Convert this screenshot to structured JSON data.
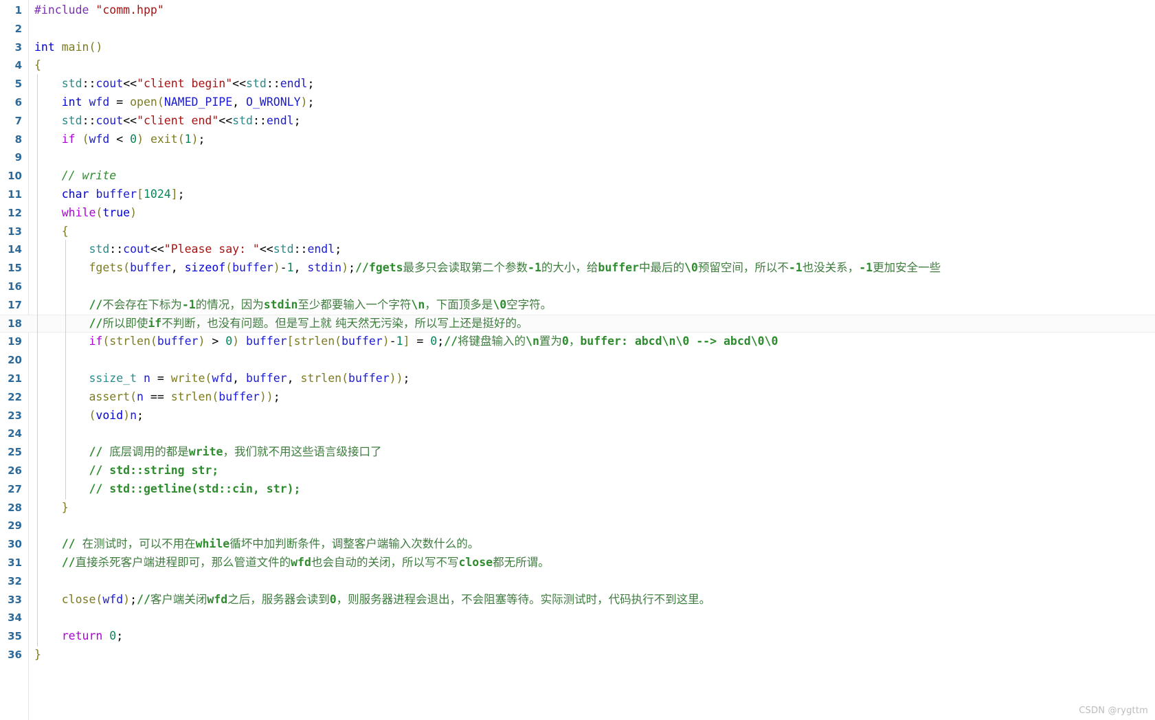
{
  "editor": {
    "language": "cpp",
    "current_line": 18,
    "total_lines": 36,
    "background_color": "#ffffff",
    "line_number_color": "#2b6a9b",
    "colors": {
      "preprocessor": "#7b2fb5",
      "string": "#a31515",
      "keyword": "#0000d8",
      "control": "#af00db",
      "type": "#2b8a8a",
      "function": "#7d7a1f",
      "number": "#098658",
      "variable": "#1b1bd0",
      "comment": "#2e8b2e",
      "plain": "#000000"
    }
  },
  "watermark": "CSDN @rygttm",
  "lines": [
    {
      "n": 1,
      "indent": 0,
      "tokens": [
        {
          "c": "t-pre",
          "t": "#include"
        },
        {
          "c": "t-plain",
          "t": " "
        },
        {
          "c": "t-str",
          "t": "\"comm.hpp\""
        }
      ]
    },
    {
      "n": 2,
      "indent": 0,
      "tokens": []
    },
    {
      "n": 3,
      "indent": 0,
      "tokens": [
        {
          "c": "t-kw",
          "t": "int"
        },
        {
          "c": "t-plain",
          "t": " "
        },
        {
          "c": "t-fn",
          "t": "main"
        },
        {
          "c": "t-brk",
          "t": "()"
        }
      ]
    },
    {
      "n": 4,
      "indent": 0,
      "tokens": [
        {
          "c": "t-brk",
          "t": "{"
        }
      ]
    },
    {
      "n": 5,
      "indent": 1,
      "tokens": [
        {
          "c": "t-ns",
          "t": "std"
        },
        {
          "c": "t-plain",
          "t": "::"
        },
        {
          "c": "t-var",
          "t": "cout"
        },
        {
          "c": "t-plain",
          "t": "<<"
        },
        {
          "c": "t-str",
          "t": "\"client begin\""
        },
        {
          "c": "t-plain",
          "t": "<<"
        },
        {
          "c": "t-ns",
          "t": "std"
        },
        {
          "c": "t-plain",
          "t": "::"
        },
        {
          "c": "t-var",
          "t": "endl"
        },
        {
          "c": "t-plain",
          "t": ";"
        }
      ]
    },
    {
      "n": 6,
      "indent": 1,
      "tokens": [
        {
          "c": "t-kw",
          "t": "int"
        },
        {
          "c": "t-plain",
          "t": " "
        },
        {
          "c": "t-var",
          "t": "wfd"
        },
        {
          "c": "t-plain",
          "t": " = "
        },
        {
          "c": "t-fn",
          "t": "open"
        },
        {
          "c": "t-brk",
          "t": "("
        },
        {
          "c": "t-var",
          "t": "NAMED_PIPE"
        },
        {
          "c": "t-plain",
          "t": ", "
        },
        {
          "c": "t-var",
          "t": "O_WRONLY"
        },
        {
          "c": "t-brk",
          "t": ")"
        },
        {
          "c": "t-plain",
          "t": ";"
        }
      ]
    },
    {
      "n": 7,
      "indent": 1,
      "tokens": [
        {
          "c": "t-ns",
          "t": "std"
        },
        {
          "c": "t-plain",
          "t": "::"
        },
        {
          "c": "t-var",
          "t": "cout"
        },
        {
          "c": "t-plain",
          "t": "<<"
        },
        {
          "c": "t-str",
          "t": "\"client end\""
        },
        {
          "c": "t-plain",
          "t": "<<"
        },
        {
          "c": "t-ns",
          "t": "std"
        },
        {
          "c": "t-plain",
          "t": "::"
        },
        {
          "c": "t-var",
          "t": "endl"
        },
        {
          "c": "t-plain",
          "t": ";"
        }
      ]
    },
    {
      "n": 8,
      "indent": 1,
      "tokens": [
        {
          "c": "t-ctrl",
          "t": "if"
        },
        {
          "c": "t-plain",
          "t": " "
        },
        {
          "c": "t-brk",
          "t": "("
        },
        {
          "c": "t-var",
          "t": "wfd"
        },
        {
          "c": "t-plain",
          "t": " < "
        },
        {
          "c": "t-num",
          "t": "0"
        },
        {
          "c": "t-brk",
          "t": ")"
        },
        {
          "c": "t-plain",
          "t": " "
        },
        {
          "c": "t-fn",
          "t": "exit"
        },
        {
          "c": "t-brk",
          "t": "("
        },
        {
          "c": "t-num",
          "t": "1"
        },
        {
          "c": "t-brk",
          "t": ")"
        },
        {
          "c": "t-plain",
          "t": ";"
        }
      ]
    },
    {
      "n": 9,
      "indent": 1,
      "tokens": []
    },
    {
      "n": 10,
      "indent": 1,
      "tokens": [
        {
          "c": "t-com",
          "t": "// write"
        }
      ]
    },
    {
      "n": 11,
      "indent": 1,
      "tokens": [
        {
          "c": "t-kw",
          "t": "char"
        },
        {
          "c": "t-plain",
          "t": " "
        },
        {
          "c": "t-var",
          "t": "buffer"
        },
        {
          "c": "t-brk",
          "t": "["
        },
        {
          "c": "t-num",
          "t": "1024"
        },
        {
          "c": "t-brk",
          "t": "]"
        },
        {
          "c": "t-plain",
          "t": ";"
        }
      ]
    },
    {
      "n": 12,
      "indent": 1,
      "tokens": [
        {
          "c": "t-ctrl",
          "t": "while"
        },
        {
          "c": "t-brk",
          "t": "("
        },
        {
          "c": "t-kw",
          "t": "true"
        },
        {
          "c": "t-brk",
          "t": ")"
        }
      ]
    },
    {
      "n": 13,
      "indent": 1,
      "tokens": [
        {
          "c": "t-brk",
          "t": "{"
        }
      ]
    },
    {
      "n": 14,
      "indent": 2,
      "tokens": [
        {
          "c": "t-ns",
          "t": "std"
        },
        {
          "c": "t-plain",
          "t": "::"
        },
        {
          "c": "t-var",
          "t": "cout"
        },
        {
          "c": "t-plain",
          "t": "<<"
        },
        {
          "c": "t-str",
          "t": "\"Please say: \""
        },
        {
          "c": "t-plain",
          "t": "<<"
        },
        {
          "c": "t-ns",
          "t": "std"
        },
        {
          "c": "t-plain",
          "t": "::"
        },
        {
          "c": "t-var",
          "t": "endl"
        },
        {
          "c": "t-plain",
          "t": ";"
        }
      ]
    },
    {
      "n": 15,
      "indent": 2,
      "tokens": [
        {
          "c": "t-fn",
          "t": "fgets"
        },
        {
          "c": "t-brk",
          "t": "("
        },
        {
          "c": "t-var",
          "t": "buffer"
        },
        {
          "c": "t-plain",
          "t": ", "
        },
        {
          "c": "t-kw",
          "t": "sizeof"
        },
        {
          "c": "t-brk",
          "t": "("
        },
        {
          "c": "t-var",
          "t": "buffer"
        },
        {
          "c": "t-brk",
          "t": ")"
        },
        {
          "c": "t-plain",
          "t": "-"
        },
        {
          "c": "t-num",
          "t": "1"
        },
        {
          "c": "t-plain",
          "t": ", "
        },
        {
          "c": "t-var",
          "t": "stdin"
        },
        {
          "c": "t-brk",
          "t": ")"
        },
        {
          "c": "t-plain",
          "t": ";"
        },
        {
          "c": "t-com-code",
          "t": "//fgets"
        },
        {
          "c": "t-com-cjk",
          "t": "最多只会读取第二个参数"
        },
        {
          "c": "t-com-code",
          "t": "-1"
        },
        {
          "c": "t-com-cjk",
          "t": "的大小，给"
        },
        {
          "c": "t-com-code",
          "t": "buffer"
        },
        {
          "c": "t-com-cjk",
          "t": "中最后的"
        },
        {
          "c": "t-com-code",
          "t": "\\0"
        },
        {
          "c": "t-com-cjk",
          "t": "预留空间，所以不"
        },
        {
          "c": "t-com-code",
          "t": "-1"
        },
        {
          "c": "t-com-cjk",
          "t": "也没关系，"
        },
        {
          "c": "t-com-code",
          "t": "-1"
        },
        {
          "c": "t-com-cjk",
          "t": "更加安全一些"
        }
      ]
    },
    {
      "n": 16,
      "indent": 2,
      "tokens": []
    },
    {
      "n": 17,
      "indent": 2,
      "tokens": [
        {
          "c": "t-com-code",
          "t": "//"
        },
        {
          "c": "t-com-cjk",
          "t": "不会存在下标为"
        },
        {
          "c": "t-com-code",
          "t": "-1"
        },
        {
          "c": "t-com-cjk",
          "t": "的情况，因为"
        },
        {
          "c": "t-com-code",
          "t": "stdin"
        },
        {
          "c": "t-com-cjk",
          "t": "至少都要输入一个字符"
        },
        {
          "c": "t-com-code",
          "t": "\\n"
        },
        {
          "c": "t-com-cjk",
          "t": "，下面顶多是"
        },
        {
          "c": "t-com-code",
          "t": "\\0"
        },
        {
          "c": "t-com-cjk",
          "t": "空字符。"
        }
      ]
    },
    {
      "n": 18,
      "indent": 2,
      "tokens": [
        {
          "c": "t-com-code",
          "t": "//"
        },
        {
          "c": "t-com-cjk",
          "t": "所以即使"
        },
        {
          "c": "t-com-code",
          "t": "if"
        },
        {
          "c": "t-com-cjk",
          "t": "不判断，也没有问题。但是写上就 纯天然无污染，所以写上还是挺好的。"
        }
      ]
    },
    {
      "n": 19,
      "indent": 2,
      "tokens": [
        {
          "c": "t-ctrl",
          "t": "if"
        },
        {
          "c": "t-brk",
          "t": "("
        },
        {
          "c": "t-fn",
          "t": "strlen"
        },
        {
          "c": "t-brk",
          "t": "("
        },
        {
          "c": "t-var",
          "t": "buffer"
        },
        {
          "c": "t-brk",
          "t": ")"
        },
        {
          "c": "t-plain",
          "t": " > "
        },
        {
          "c": "t-num",
          "t": "0"
        },
        {
          "c": "t-brk",
          "t": ")"
        },
        {
          "c": "t-plain",
          "t": " "
        },
        {
          "c": "t-var",
          "t": "buffer"
        },
        {
          "c": "t-brk",
          "t": "["
        },
        {
          "c": "t-fn",
          "t": "strlen"
        },
        {
          "c": "t-brk",
          "t": "("
        },
        {
          "c": "t-var",
          "t": "buffer"
        },
        {
          "c": "t-brk",
          "t": ")"
        },
        {
          "c": "t-plain",
          "t": "-"
        },
        {
          "c": "t-num",
          "t": "1"
        },
        {
          "c": "t-brk",
          "t": "]"
        },
        {
          "c": "t-plain",
          "t": " = "
        },
        {
          "c": "t-num",
          "t": "0"
        },
        {
          "c": "t-plain",
          "t": ";"
        },
        {
          "c": "t-com-code",
          "t": "//"
        },
        {
          "c": "t-com-cjk",
          "t": "将键盘输入的"
        },
        {
          "c": "t-com-code",
          "t": "\\n"
        },
        {
          "c": "t-com-cjk",
          "t": "置为"
        },
        {
          "c": "t-com-code",
          "t": "0"
        },
        {
          "c": "t-com-cjk",
          "t": "，"
        },
        {
          "c": "t-com-code",
          "t": "buffer: abcd\\n\\0 --> abcd\\0\\0"
        }
      ]
    },
    {
      "n": 20,
      "indent": 2,
      "tokens": []
    },
    {
      "n": 21,
      "indent": 2,
      "tokens": [
        {
          "c": "t-type",
          "t": "ssize_t"
        },
        {
          "c": "t-plain",
          "t": " "
        },
        {
          "c": "t-var",
          "t": "n"
        },
        {
          "c": "t-plain",
          "t": " = "
        },
        {
          "c": "t-fn",
          "t": "write"
        },
        {
          "c": "t-brk",
          "t": "("
        },
        {
          "c": "t-var",
          "t": "wfd"
        },
        {
          "c": "t-plain",
          "t": ", "
        },
        {
          "c": "t-var",
          "t": "buffer"
        },
        {
          "c": "t-plain",
          "t": ", "
        },
        {
          "c": "t-fn",
          "t": "strlen"
        },
        {
          "c": "t-brk",
          "t": "("
        },
        {
          "c": "t-var",
          "t": "buffer"
        },
        {
          "c": "t-brk",
          "t": "))"
        },
        {
          "c": "t-plain",
          "t": ";"
        }
      ]
    },
    {
      "n": 22,
      "indent": 2,
      "tokens": [
        {
          "c": "t-fn",
          "t": "assert"
        },
        {
          "c": "t-brk",
          "t": "("
        },
        {
          "c": "t-var",
          "t": "n"
        },
        {
          "c": "t-plain",
          "t": " == "
        },
        {
          "c": "t-fn",
          "t": "strlen"
        },
        {
          "c": "t-brk",
          "t": "("
        },
        {
          "c": "t-var",
          "t": "buffer"
        },
        {
          "c": "t-brk",
          "t": "))"
        },
        {
          "c": "t-plain",
          "t": ";"
        }
      ]
    },
    {
      "n": 23,
      "indent": 2,
      "tokens": [
        {
          "c": "t-brk",
          "t": "("
        },
        {
          "c": "t-kw",
          "t": "void"
        },
        {
          "c": "t-brk",
          "t": ")"
        },
        {
          "c": "t-var",
          "t": "n"
        },
        {
          "c": "t-plain",
          "t": ";"
        }
      ]
    },
    {
      "n": 24,
      "indent": 2,
      "tokens": []
    },
    {
      "n": 25,
      "indent": 2,
      "tokens": [
        {
          "c": "t-com-code",
          "t": "// "
        },
        {
          "c": "t-com-cjk",
          "t": "底层调用的都是"
        },
        {
          "c": "t-com-code",
          "t": "write"
        },
        {
          "c": "t-com-cjk",
          "t": "，我们就不用这些语言级接口了"
        }
      ]
    },
    {
      "n": 26,
      "indent": 2,
      "tokens": [
        {
          "c": "t-com-code",
          "t": "// std::string str;"
        }
      ]
    },
    {
      "n": 27,
      "indent": 2,
      "tokens": [
        {
          "c": "t-com-code",
          "t": "// std::getline(std::cin, str);"
        }
      ]
    },
    {
      "n": 28,
      "indent": 1,
      "tokens": [
        {
          "c": "t-brk",
          "t": "}"
        }
      ]
    },
    {
      "n": 29,
      "indent": 1,
      "tokens": []
    },
    {
      "n": 30,
      "indent": 1,
      "tokens": [
        {
          "c": "t-com-code",
          "t": "// "
        },
        {
          "c": "t-com-cjk",
          "t": "在测试时，可以不用在"
        },
        {
          "c": "t-com-code",
          "t": "while"
        },
        {
          "c": "t-com-cjk",
          "t": "循坏中加判断条件，调整客户端输入次数什么的。"
        }
      ]
    },
    {
      "n": 31,
      "indent": 1,
      "tokens": [
        {
          "c": "t-com-code",
          "t": "//"
        },
        {
          "c": "t-com-cjk",
          "t": "直接杀死客户端进程即可，那么管道文件的"
        },
        {
          "c": "t-com-code",
          "t": "wfd"
        },
        {
          "c": "t-com-cjk",
          "t": "也会自动的关闭，所以写不写"
        },
        {
          "c": "t-com-code",
          "t": "close"
        },
        {
          "c": "t-com-cjk",
          "t": "都无所谓。"
        }
      ]
    },
    {
      "n": 32,
      "indent": 1,
      "tokens": []
    },
    {
      "n": 33,
      "indent": 1,
      "tokens": [
        {
          "c": "t-fn",
          "t": "close"
        },
        {
          "c": "t-brk",
          "t": "("
        },
        {
          "c": "t-var",
          "t": "wfd"
        },
        {
          "c": "t-brk",
          "t": ")"
        },
        {
          "c": "t-plain",
          "t": ";"
        },
        {
          "c": "t-com-code",
          "t": "//"
        },
        {
          "c": "t-com-cjk",
          "t": "客户端关闭"
        },
        {
          "c": "t-com-code",
          "t": "wfd"
        },
        {
          "c": "t-com-cjk",
          "t": "之后，服务器会读到"
        },
        {
          "c": "t-com-code",
          "t": "0"
        },
        {
          "c": "t-com-cjk",
          "t": "，则服务器进程会退出，不会阻塞等待。实际测试时，代码执行不到这里。"
        }
      ]
    },
    {
      "n": 34,
      "indent": 1,
      "tokens": []
    },
    {
      "n": 35,
      "indent": 1,
      "tokens": [
        {
          "c": "t-ctrl",
          "t": "return"
        },
        {
          "c": "t-plain",
          "t": " "
        },
        {
          "c": "t-num",
          "t": "0"
        },
        {
          "c": "t-plain",
          "t": ";"
        }
      ]
    },
    {
      "n": 36,
      "indent": 0,
      "tokens": [
        {
          "c": "t-brk",
          "t": "}"
        }
      ]
    }
  ]
}
